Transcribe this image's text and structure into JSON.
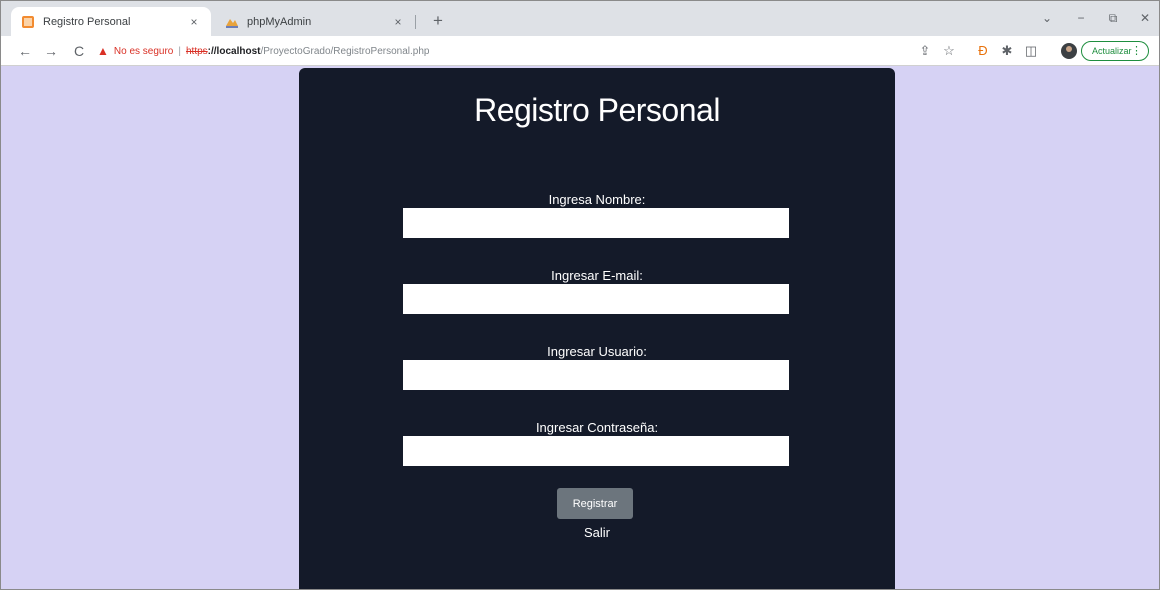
{
  "browser": {
    "tabs": [
      {
        "title": "Registro Personal",
        "active": true,
        "icon": "page-favicon",
        "color": "#f28b30"
      },
      {
        "title": "phpMyAdmin",
        "active": false,
        "icon": "phpmyadmin-favicon",
        "color": "#e8a33d"
      }
    ],
    "tab_close_glyph": "×",
    "new_tab_glyph": "+",
    "window_controls": {
      "minimize": "−",
      "restore": "⧉",
      "close": "✕"
    },
    "nav": {
      "back": "←",
      "forward": "→",
      "reload": "C"
    },
    "url": {
      "warning_glyph": "▲",
      "security_text": "No es seguro",
      "separator": "|",
      "scheme": "https",
      "host": "://localhost",
      "path": "/ProyectoGrado/RegistroPersonal.php"
    },
    "toolbar_icons": {
      "share": "⇪",
      "bookmark": "☆",
      "extension": "Ð",
      "puzzle": "✱",
      "sidepanel": "◫"
    },
    "update_label": "Actualizar",
    "menu_glyph": "⋮"
  },
  "form": {
    "title": "Registro Personal",
    "fields": [
      {
        "label": "Ingresa Nombre:",
        "value": ""
      },
      {
        "label": "Ingresar E-mail:",
        "value": ""
      },
      {
        "label": "Ingresar Usuario:",
        "value": ""
      },
      {
        "label": "Ingresar Contraseña:",
        "value": ""
      }
    ],
    "submit_label": "Registrar",
    "exit_label": "Salir"
  },
  "colors": {
    "page_background": "#d6d2f4",
    "card_background": "#141a29",
    "button_background": "#6c757d",
    "warning": "#d93025"
  }
}
